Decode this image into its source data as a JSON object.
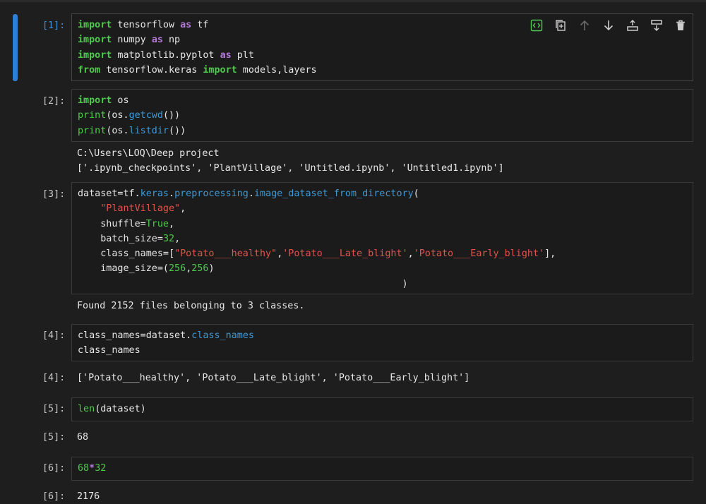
{
  "cells": [
    {
      "id": "1",
      "prompt": "[1]:",
      "code": [
        [
          [
            "kw",
            "import"
          ],
          [
            "txt",
            " tensorflow "
          ],
          [
            "op",
            "as"
          ],
          [
            "txt",
            " tf"
          ]
        ],
        [
          [
            "kw",
            "import"
          ],
          [
            "txt",
            " numpy "
          ],
          [
            "op",
            "as"
          ],
          [
            "txt",
            " np"
          ]
        ],
        [
          [
            "kw",
            "import"
          ],
          [
            "txt",
            " matplotlib.pyplot "
          ],
          [
            "op",
            "as"
          ],
          [
            "txt",
            " plt"
          ]
        ],
        [
          [
            "kw",
            "from"
          ],
          [
            "txt",
            " tensorflow.keras "
          ],
          [
            "kw",
            "import"
          ],
          [
            "txt",
            " models,layers"
          ]
        ]
      ]
    },
    {
      "id": "2",
      "prompt": "[2]:",
      "code": [
        [
          [
            "kw",
            "import"
          ],
          [
            "txt",
            " os"
          ]
        ],
        [
          [
            "fn",
            "print"
          ],
          [
            "txt",
            "(os."
          ],
          [
            "attr",
            "getcwd"
          ],
          [
            "txt",
            "())"
          ]
        ],
        [
          [
            "fn",
            "print"
          ],
          [
            "txt",
            "(os."
          ],
          [
            "attr",
            "listdir"
          ],
          [
            "txt",
            "())"
          ]
        ]
      ],
      "output": [
        "C:\\Users\\LOQ\\Deep project",
        "['.ipynb_checkpoints', 'PlantVillage', 'Untitled.ipynb', 'Untitled1.ipynb']"
      ]
    },
    {
      "id": "3",
      "prompt": "[3]:",
      "code": [
        [
          [
            "txt",
            "dataset=tf."
          ],
          [
            "attr",
            "keras"
          ],
          [
            "txt",
            "."
          ],
          [
            "attr",
            "preprocessing"
          ],
          [
            "txt",
            "."
          ],
          [
            "attr",
            "image_dataset_from_directory"
          ],
          [
            "txt",
            "("
          ]
        ],
        [
          [
            "txt",
            "    "
          ],
          [
            "str",
            "\"PlantVillage\""
          ],
          [
            "txt",
            ","
          ]
        ],
        [
          [
            "txt",
            "    shuffle="
          ],
          [
            "bool",
            "True"
          ],
          [
            "txt",
            ","
          ]
        ],
        [
          [
            "txt",
            "    batch_size="
          ],
          [
            "num",
            "32"
          ],
          [
            "txt",
            ","
          ]
        ],
        [
          [
            "txt",
            "    class_names=["
          ],
          [
            "str",
            "\"Potato___healthy\""
          ],
          [
            "txt",
            ","
          ],
          [
            "str",
            "'Potato___Late_blight'"
          ],
          [
            "txt",
            ","
          ],
          [
            "str",
            "'Potato___Early_blight'"
          ],
          [
            "txt",
            "],"
          ]
        ],
        [
          [
            "txt",
            "    image_size=("
          ],
          [
            "num",
            "256"
          ],
          [
            "txt",
            ","
          ],
          [
            "num",
            "256"
          ],
          [
            "txt",
            ")"
          ]
        ],
        [
          [
            "txt",
            "                                                         )"
          ]
        ]
      ],
      "output": [
        "Found 2152 files belonging to 3 classes."
      ]
    },
    {
      "id": "4",
      "prompt": "[4]:",
      "code": [
        [
          [
            "txt",
            "class_names=dataset."
          ],
          [
            "attr",
            "class_names"
          ]
        ],
        [
          [
            "txt",
            "class_names"
          ]
        ]
      ],
      "out_prompt": "[4]:",
      "output": [
        "['Potato___healthy', 'Potato___Late_blight', 'Potato___Early_blight']"
      ]
    },
    {
      "id": "5",
      "prompt": "[5]:",
      "code": [
        [
          [
            "fn",
            "len"
          ],
          [
            "txt",
            "(dataset)"
          ]
        ]
      ],
      "out_prompt": "[5]:",
      "output": [
        "68"
      ]
    },
    {
      "id": "6",
      "prompt": "[6]:",
      "code": [
        [
          [
            "num",
            "68"
          ],
          [
            "op",
            "*"
          ],
          [
            "num",
            "32"
          ]
        ]
      ],
      "out_prompt": "[6]:",
      "output": [
        "2176"
      ]
    }
  ],
  "toolbar": [
    {
      "name": "render-side-by-side-icon",
      "color": "#4ec94e"
    },
    {
      "name": "duplicate-cell-icon",
      "color": "#cccccc"
    },
    {
      "name": "move-up-icon",
      "color": "#6a6a6a"
    },
    {
      "name": "move-down-icon",
      "color": "#cccccc"
    },
    {
      "name": "insert-above-icon",
      "color": "#cccccc"
    },
    {
      "name": "insert-below-icon",
      "color": "#cccccc"
    },
    {
      "name": "delete-cell-icon",
      "color": "#cccccc"
    }
  ],
  "colors": {
    "background": "#1e1e1e",
    "cell_background": "#1b1b1b",
    "active_indicator": "#2f7fd4",
    "keyword": "#4ec94e",
    "string": "#e0554b",
    "attribute": "#3d9ad6",
    "operator": "#b27ad6",
    "prompt_in": "#3f8ed8"
  }
}
